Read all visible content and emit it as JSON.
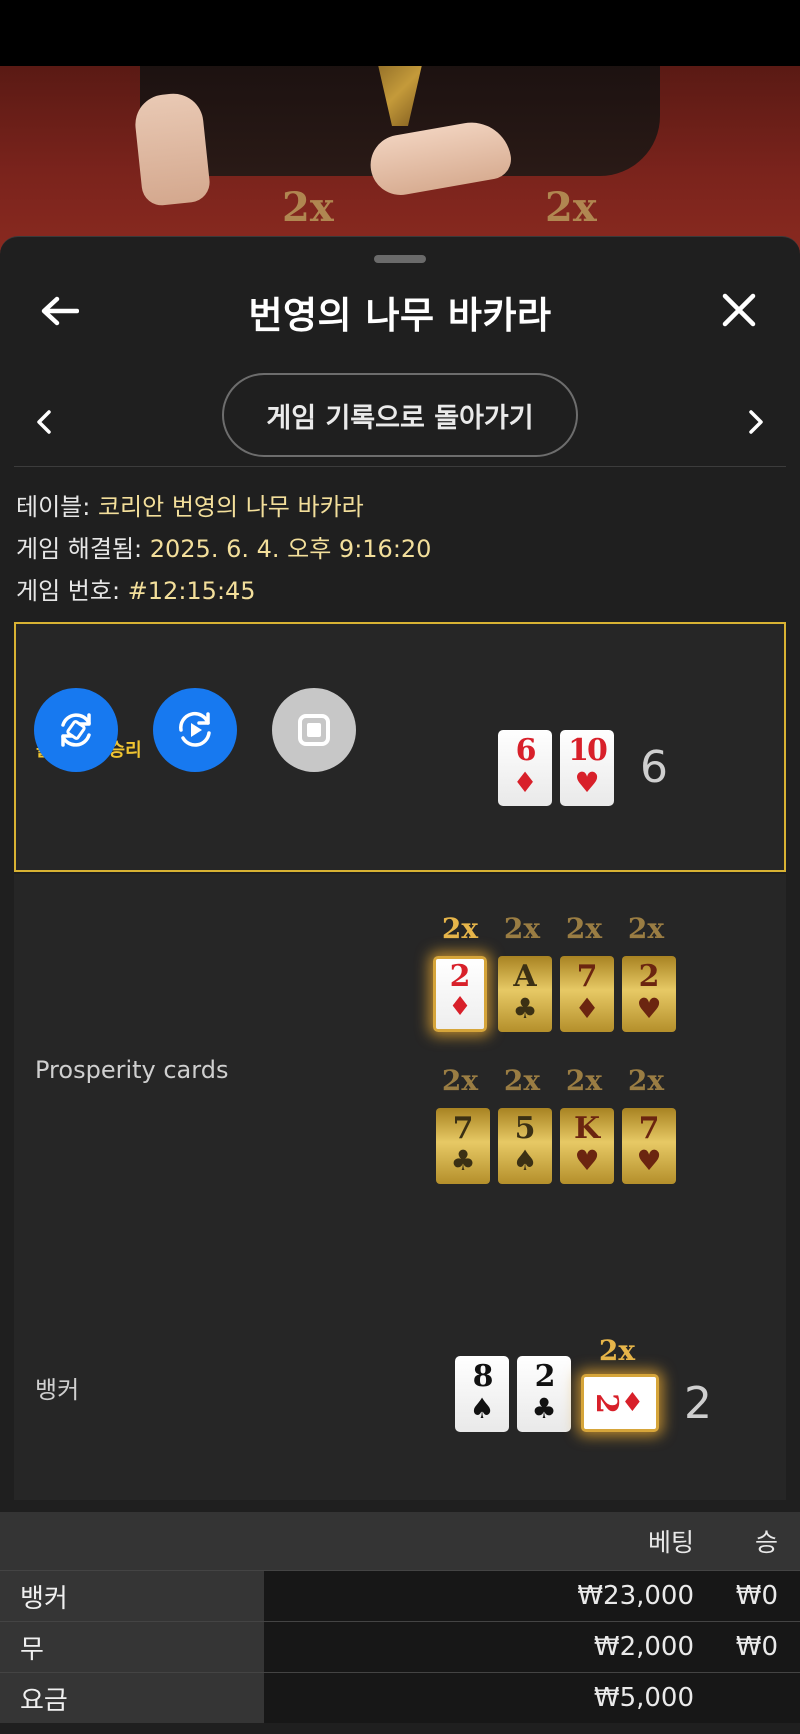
{
  "table_multipliers": [
    "2x",
    "2x"
  ],
  "header": {
    "title": "번영의 나무 바카라",
    "back_history_label": "게임 기록으로 돌아가기"
  },
  "info": {
    "table_label": "테이블: ",
    "table_value": "코리안 번영의 나무 바카라",
    "resolved_label": "게임 해결됨: ",
    "resolved_value": "2025. 6. 4. 오후 9:16:20",
    "number_label": "게임 번호: ",
    "number_value": "#12:15:45"
  },
  "player": {
    "label": "플레이어 승리",
    "cards": [
      {
        "rank": "6",
        "suit": "♦",
        "color": "#d8202a"
      },
      {
        "rank": "10",
        "suit": "♥",
        "color": "#d8202a"
      }
    ],
    "score": "6"
  },
  "prosperity": {
    "label": "Prosperity cards",
    "row1": [
      {
        "mult": "2x",
        "rank": "2",
        "suit": "♦",
        "highlighted": true
      },
      {
        "mult": "2x",
        "rank": "A",
        "suit": "♣",
        "highlighted": false
      },
      {
        "mult": "2x",
        "rank": "7",
        "suit": "♦",
        "highlighted": false
      },
      {
        "mult": "2x",
        "rank": "2",
        "suit": "♥",
        "highlighted": false
      }
    ],
    "row2": [
      {
        "mult": "2x",
        "rank": "7",
        "suit": "♣",
        "highlighted": false
      },
      {
        "mult": "2x",
        "rank": "5",
        "suit": "♠",
        "highlighted": false
      },
      {
        "mult": "2x",
        "rank": "K",
        "suit": "♥",
        "highlighted": false
      },
      {
        "mult": "2x",
        "rank": "7",
        "suit": "♥",
        "highlighted": false
      }
    ]
  },
  "banker": {
    "label": "뱅커",
    "cards": [
      {
        "rank": "8",
        "suit": "♠"
      },
      {
        "rank": "2",
        "suit": "♣"
      }
    ],
    "third_card": {
      "mult": "2x",
      "rank": "2",
      "suit": "♦"
    },
    "score": "2"
  },
  "bets": {
    "head_bet": "베팅",
    "head_win": "승",
    "rows": [
      {
        "name": "뱅커",
        "bet": "₩23,000",
        "win": "₩0"
      },
      {
        "name": "무",
        "bet": "₩2,000",
        "win": "₩0"
      },
      {
        "name": "요금",
        "bet": "₩5,000",
        "win": ""
      }
    ]
  },
  "colors": {
    "accent_blue": "#1779f0",
    "gold": "#d8b233",
    "info_value": "#f3df9b"
  }
}
